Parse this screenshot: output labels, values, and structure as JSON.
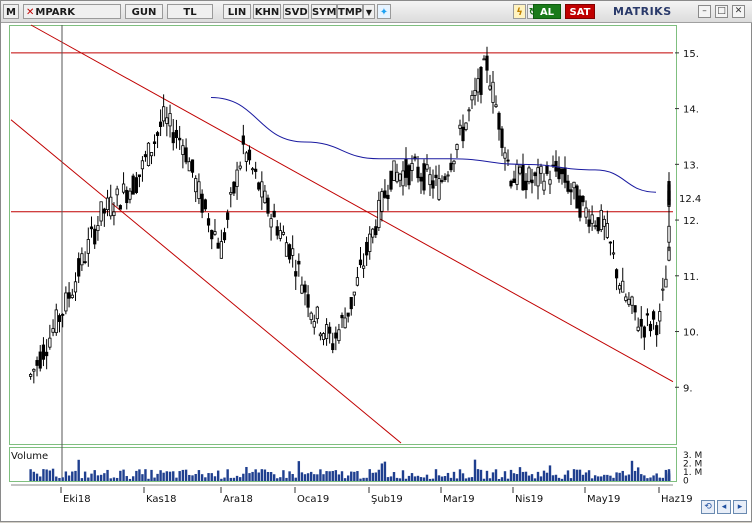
{
  "toolbar": {
    "menu_label": "M",
    "symbol": "MPARK",
    "period": "GUN",
    "currency": "TL",
    "scale_lin": "LIN",
    "khn": "KHN",
    "svd": "SVD",
    "sym": "SYM",
    "tmp": "TMP",
    "al": "AL",
    "sat": "SAT",
    "brand": "MATRIKS"
  },
  "volume_panel": {
    "title": "Volume",
    "ticks": [
      "3. M",
      "2. M",
      "1. M",
      "0"
    ]
  },
  "colors": {
    "candle": "#000000",
    "channel_lines": "#c00000",
    "moving_average": "#1a1aa0",
    "volume_bars": "#1f3f8f",
    "panel_border": "#7fbf7f"
  },
  "chart_data": {
    "type": "candlestick",
    "symbol": "MPARK",
    "x_ticks": [
      "Eki18",
      "Kas18",
      "Ara18",
      "Oca19",
      "Şub19",
      "Mar19",
      "Nis19",
      "May19",
      "Haz19"
    ],
    "y_ticks": [
      9,
      10,
      11,
      12,
      13,
      14,
      15
    ],
    "y_tick_labels": [
      "9.",
      "10.",
      "11.",
      "12.",
      "13.",
      "14.",
      "15."
    ],
    "ylim": [
      8.0,
      15.5
    ],
    "last_value_label": "12.4",
    "horizontal_lines": [
      15.0,
      12.15
    ],
    "close_path": [
      [
        "Eki18",
        9.2
      ],
      [
        "Eki18",
        10.5
      ],
      [
        "Eki18",
        12.1
      ],
      [
        "Eki18",
        12.7
      ],
      [
        "Kas18",
        13.8
      ],
      [
        "Kas18",
        13.4
      ],
      [
        "Kas18",
        12.3
      ],
      [
        "Kas18",
        11.5
      ],
      [
        "Ara18",
        13.3
      ],
      [
        "Ara18",
        12.2
      ],
      [
        "Ara18",
        11.4
      ],
      [
        "Oca19",
        10.3
      ],
      [
        "Oca19",
        9.8
      ],
      [
        "Oca19",
        10.5
      ],
      [
        "Oca19",
        11.6
      ],
      [
        "Şub19",
        12.8
      ],
      [
        "Şub19",
        12.9
      ],
      [
        "Şub19",
        12.6
      ],
      [
        "Mar19",
        13.6
      ],
      [
        "Mar19",
        14.8
      ],
      [
        "Mar19",
        12.8
      ],
      [
        "Nis19",
        12.7
      ],
      [
        "Nis19",
        12.9
      ],
      [
        "Nis19",
        12.2
      ],
      [
        "May19",
        11.9
      ],
      [
        "May19",
        10.7
      ],
      [
        "May19",
        10.1
      ],
      [
        "May19",
        10.2
      ],
      [
        "Haz19",
        11.3
      ],
      [
        "Haz19",
        12.4
      ],
      [
        "Haz19",
        12.6
      ],
      [
        "Haz19",
        12.4
      ]
    ],
    "moving_average": [
      [
        "Ara18",
        14.2
      ],
      [
        "Oca19",
        13.4
      ],
      [
        "Şub19",
        13.1
      ],
      [
        "Mar19",
        13.1
      ],
      [
        "Nis19",
        13.0
      ],
      [
        "May19",
        12.9
      ],
      [
        "Haz19",
        12.5
      ]
    ],
    "channel_upper": [
      [
        "Eki18",
        15.5
      ],
      [
        "Haz19",
        9.1
      ]
    ],
    "channel_lower": [
      [
        "Eki18",
        13.8
      ],
      [
        "Oca19",
        8.0
      ]
    ],
    "grid": false
  }
}
